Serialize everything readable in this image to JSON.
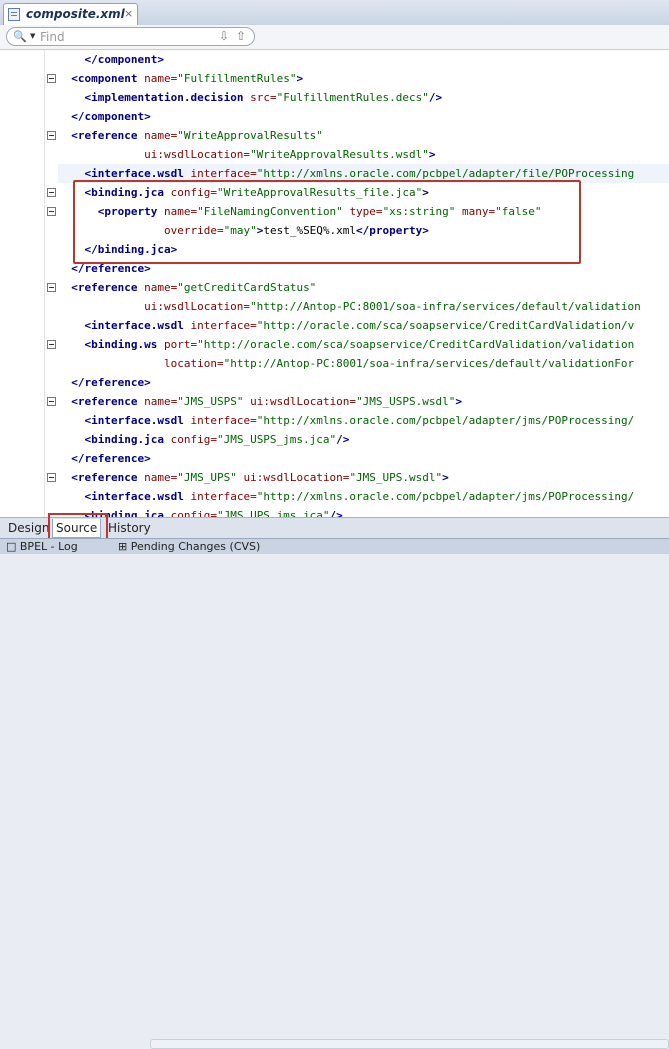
{
  "tab": {
    "title": "composite.xml",
    "close": "×"
  },
  "find": {
    "placeholder": "Find"
  },
  "code_lines": [
    {
      "parts": [
        [
          "x",
          "    "
        ],
        [
          "t",
          "</component>"
        ]
      ]
    },
    {
      "parts": [
        [
          "x",
          "  "
        ],
        [
          "t",
          "<component "
        ],
        [
          "a",
          "name="
        ],
        [
          "v",
          "\"FulfillmentRules\""
        ],
        [
          "t",
          ">"
        ]
      ]
    },
    {
      "parts": [
        [
          "x",
          "    "
        ],
        [
          "t",
          "<implementation.decision "
        ],
        [
          "a",
          "src="
        ],
        [
          "v",
          "\"FulfillmentRules.decs\""
        ],
        [
          "t",
          "/>"
        ]
      ]
    },
    {
      "parts": [
        [
          "x",
          "  "
        ],
        [
          "t",
          "</component>"
        ]
      ]
    },
    {
      "parts": [
        [
          "x",
          "  "
        ],
        [
          "t",
          "<reference "
        ],
        [
          "a",
          "name="
        ],
        [
          "v",
          "\"WriteApprovalResults\""
        ]
      ]
    },
    {
      "parts": [
        [
          "x",
          "             "
        ],
        [
          "a",
          "ui:wsdlLocation="
        ],
        [
          "v",
          "\"WriteApprovalResults.wsdl\""
        ],
        [
          "t",
          ">"
        ]
      ]
    },
    {
      "parts": [
        [
          "x",
          "    "
        ],
        [
          "t",
          "<interface.wsdl "
        ],
        [
          "a",
          "interface="
        ],
        [
          "v",
          "\"http://xmlns.oracle.com/pcbpel/adapter/file/POProcessing"
        ]
      ]
    },
    {
      "parts": [
        [
          "x",
          "    "
        ],
        [
          "t",
          "<binding.jca "
        ],
        [
          "a",
          "config="
        ],
        [
          "v",
          "\"WriteApprovalResults_file.jca\""
        ],
        [
          "t",
          ">"
        ]
      ]
    },
    {
      "parts": [
        [
          "x",
          "      "
        ],
        [
          "t",
          "<property "
        ],
        [
          "a",
          "name="
        ],
        [
          "v",
          "\"FileNamingConvention\" "
        ],
        [
          "a",
          "type="
        ],
        [
          "v",
          "\"xs:string\" "
        ],
        [
          "a",
          "many="
        ],
        [
          "v",
          "\"false\""
        ]
      ]
    },
    {
      "parts": [
        [
          "x",
          "                "
        ],
        [
          "a",
          "override="
        ],
        [
          "v",
          "\"may\""
        ],
        [
          "t",
          ">"
        ],
        [
          "x",
          "test_%SEQ%.xml"
        ],
        [
          "t",
          "</property>"
        ]
      ]
    },
    {
      "parts": [
        [
          "x",
          "    "
        ],
        [
          "t",
          "</binding.jca>"
        ]
      ]
    },
    {
      "parts": [
        [
          "x",
          "  "
        ],
        [
          "t",
          "</reference>"
        ]
      ]
    },
    {
      "parts": [
        [
          "x",
          "  "
        ],
        [
          "t",
          "<reference "
        ],
        [
          "a",
          "name="
        ],
        [
          "v",
          "\"getCreditCardStatus\""
        ]
      ]
    },
    {
      "parts": [
        [
          "x",
          "             "
        ],
        [
          "a",
          "ui:wsdlLocation="
        ],
        [
          "v",
          "\"http://Antop-PC:8001/soa-infra/services/default/validation"
        ]
      ]
    },
    {
      "parts": [
        [
          "x",
          "    "
        ],
        [
          "t",
          "<interface.wsdl "
        ],
        [
          "a",
          "interface="
        ],
        [
          "v",
          "\"http://oracle.com/sca/soapservice/CreditCardValidation/v"
        ]
      ]
    },
    {
      "parts": [
        [
          "x",
          "    "
        ],
        [
          "t",
          "<binding.ws "
        ],
        [
          "a",
          "port="
        ],
        [
          "v",
          "\"http://oracle.com/sca/soapservice/CreditCardValidation/validation"
        ]
      ]
    },
    {
      "parts": [
        [
          "x",
          "                "
        ],
        [
          "a",
          "location="
        ],
        [
          "v",
          "\"http://Antop-PC:8001/soa-infra/services/default/validationFor"
        ]
      ]
    },
    {
      "parts": [
        [
          "x",
          "  "
        ],
        [
          "t",
          "</reference>"
        ]
      ]
    },
    {
      "parts": [
        [
          "x",
          "  "
        ],
        [
          "t",
          "<reference "
        ],
        [
          "a",
          "name="
        ],
        [
          "v",
          "\"JMS_USPS\" "
        ],
        [
          "a",
          "ui:wsdlLocation="
        ],
        [
          "v",
          "\"JMS_USPS.wsdl\""
        ],
        [
          "t",
          ">"
        ]
      ]
    },
    {
      "parts": [
        [
          "x",
          "    "
        ],
        [
          "t",
          "<interface.wsdl "
        ],
        [
          "a",
          "interface="
        ],
        [
          "v",
          "\"http://xmlns.oracle.com/pcbpel/adapter/jms/POProcessing/"
        ]
      ]
    },
    {
      "parts": [
        [
          "x",
          "    "
        ],
        [
          "t",
          "<binding.jca "
        ],
        [
          "a",
          "config="
        ],
        [
          "v",
          "\"JMS_USPS_jms.jca\""
        ],
        [
          "t",
          "/>"
        ]
      ]
    },
    {
      "parts": [
        [
          "x",
          "  "
        ],
        [
          "t",
          "</reference>"
        ]
      ]
    },
    {
      "parts": [
        [
          "x",
          "  "
        ],
        [
          "t",
          "<reference "
        ],
        [
          "a",
          "name="
        ],
        [
          "v",
          "\"JMS_UPS\" "
        ],
        [
          "a",
          "ui:wsdlLocation="
        ],
        [
          "v",
          "\"JMS_UPS.wsdl\""
        ],
        [
          "t",
          ">"
        ]
      ]
    },
    {
      "parts": [
        [
          "x",
          "    "
        ],
        [
          "t",
          "<interface.wsdl "
        ],
        [
          "a",
          "interface="
        ],
        [
          "v",
          "\"http://xmlns.oracle.com/pcbpel/adapter/jms/POProcessing/"
        ]
      ]
    },
    {
      "parts": [
        [
          "x",
          "    "
        ],
        [
          "t",
          "<binding.jca "
        ],
        [
          "a",
          "config="
        ],
        [
          "v",
          "\"JMS_UPS_jms.jca\""
        ],
        [
          "t",
          "/>"
        ]
      ]
    }
  ],
  "fold_lines": [
    1,
    4,
    7,
    8,
    12,
    15,
    18,
    22
  ],
  "bottom_tabs": [
    "Design",
    "Source",
    "History"
  ],
  "active_bottom_tab": "Source",
  "status": {
    "bpel_log": "BPEL - Log",
    "pending": "Pending Changes (CVS)"
  },
  "colors": {
    "tag": "#000080",
    "attr": "#800000",
    "value": "#006400",
    "highlight": "#c0352d"
  }
}
